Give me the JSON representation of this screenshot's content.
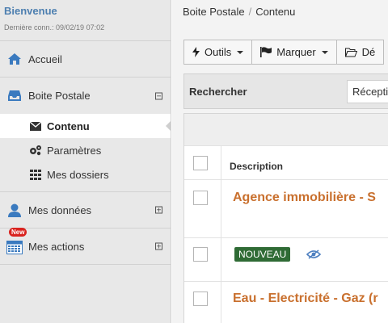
{
  "sidebar": {
    "welcome_title": "Bienvenue",
    "last_login": "Dernière conn.: 09/02/19 07:02",
    "items": [
      {
        "label": "Accueil",
        "icon": "home-icon"
      },
      {
        "label": "Boite Postale",
        "icon": "inbox-icon",
        "toggle": "⊟"
      },
      {
        "label": "Mes données",
        "icon": "user-icon",
        "toggle": "⊞"
      },
      {
        "label": "Mes actions",
        "icon": "calendar-icon",
        "toggle": "⊞",
        "badge": "New"
      }
    ],
    "subitems": [
      {
        "label": "Contenu",
        "icon": "envelope-icon",
        "active": true
      },
      {
        "label": "Paramètres",
        "icon": "gears-icon"
      },
      {
        "label": "Mes dossiers",
        "icon": "grid-icon"
      }
    ]
  },
  "breadcrumb": {
    "root": "Boite Postale",
    "separator": "/",
    "current": "Contenu"
  },
  "toolbar": {
    "tools_label": "Outils",
    "mark_label": "Marquer",
    "third_label": "Dé"
  },
  "search": {
    "label": "Rechercher",
    "select_value": "Réceptio"
  },
  "table": {
    "header_description": "Description",
    "rows": [
      {
        "title": "Agence immobilière - S"
      },
      {
        "badge": "NOUVEAU",
        "icon": "eye-slash-icon"
      },
      {
        "title": "Eau - Electricité - Gaz (r"
      }
    ]
  },
  "colors": {
    "link_orange": "#c9702e",
    "badge_green": "#2f6b35",
    "welcome_blue": "#4d7fb0",
    "icon_blue": "#3a7abf",
    "new_red": "#d9231f"
  }
}
